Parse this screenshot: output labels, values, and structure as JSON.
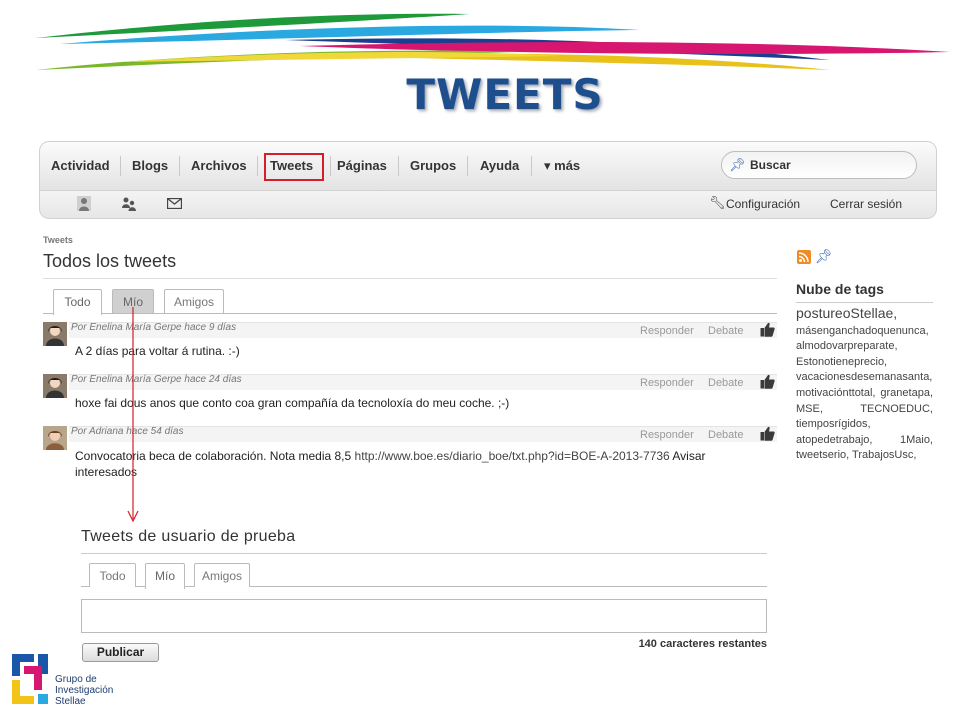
{
  "slide": {
    "title": "TWEETS"
  },
  "nav": {
    "items": [
      "Actividad",
      "Blogs",
      "Archivos",
      "Tweets",
      "Páginas",
      "Grupos",
      "Ayuda",
      "▾ más"
    ],
    "search_placeholder": "Buscar"
  },
  "subbar": {
    "settings": "Configuración",
    "logout": "Cerrar sesión"
  },
  "main": {
    "breadcrumb": "Tweets",
    "title": "Todos los tweets",
    "tabs": [
      "Todo",
      "Mío",
      "Amigos"
    ],
    "tweets": [
      {
        "meta": "Por Enelina María Gerpe hace 9 días",
        "reply": "Responder",
        "debate": "Debate",
        "text": "A 2 días para voltar á rutina. :-)"
      },
      {
        "meta": "Por Enelina María Gerpe hace 24 días",
        "reply": "Responder",
        "debate": "Debate",
        "text": "hoxe fai dous anos que conto coa gran compañía da tecnoloxía do meu coche. ;-)"
      },
      {
        "meta": "Por Adriana hace 54 días",
        "reply": "Responder",
        "debate": "Debate",
        "text_before": "Convocatoria beca de colaboración. Nota media 8,5 ",
        "link": "http://www.boe.es/diario_boe/txt.php?id=BOE-A-2013-7736",
        "text_after": " Avisar interesados"
      }
    ]
  },
  "sidebar": {
    "title": "Nube de tags",
    "first_tag": "postureoStellae,",
    "tags": "másenganchadoquenunca, almodovarpreparate, Estonotieneprecio, vacacionesdesemanasanta, motivaciónttotal, granetapa, MSE, TECNOEDUC, tiemposrígidos, atopedetrabajo, 1Maio, tweetserio, TrabajosUsc,"
  },
  "lower": {
    "title": "Tweets de usuario de prueba",
    "tabs": [
      "Todo",
      "Mío",
      "Amigos"
    ],
    "publish": "Publicar",
    "chars_left": "140 caracteres restantes"
  },
  "logo": {
    "line1": "Grupo de",
    "line2": "Investigación",
    "line3": "Stellae"
  },
  "colors": {
    "title": "#1f4e8c",
    "highlight": "#d21f2b",
    "rss": "#f08a24"
  }
}
